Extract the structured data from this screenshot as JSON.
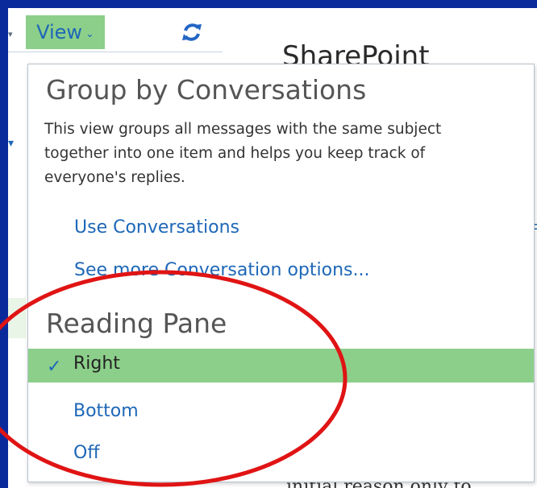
{
  "toolbar": {
    "view_label": "View",
    "view_caret": "⌄",
    "refresh_icon": "refresh-icon",
    "left_arrow": "▾"
  },
  "background": {
    "title": "SharePoint",
    "right_fragment_1": "I",
    "right_fragment_2": "F",
    "left_fragment": "▾",
    "bottom_fragment": "initial reason only to"
  },
  "menu": {
    "group_heading": "Group by Conversations",
    "group_description": "This view groups all messages with the same subject together into one item and helps you keep track of everyone's replies.",
    "use_conversations": "Use Conversations",
    "more_options": "See more Conversation options...",
    "reading_heading": "Reading Pane",
    "options": [
      {
        "label": "Right",
        "selected": true
      },
      {
        "label": "Bottom",
        "selected": false
      },
      {
        "label": "Off",
        "selected": false
      }
    ],
    "check_glyph": "✓"
  },
  "colors": {
    "frame_blue": "#0a2a9c",
    "highlight_green": "#8ccf8a",
    "link_blue": "#1e67b7",
    "annotation_red": "#e01414"
  }
}
